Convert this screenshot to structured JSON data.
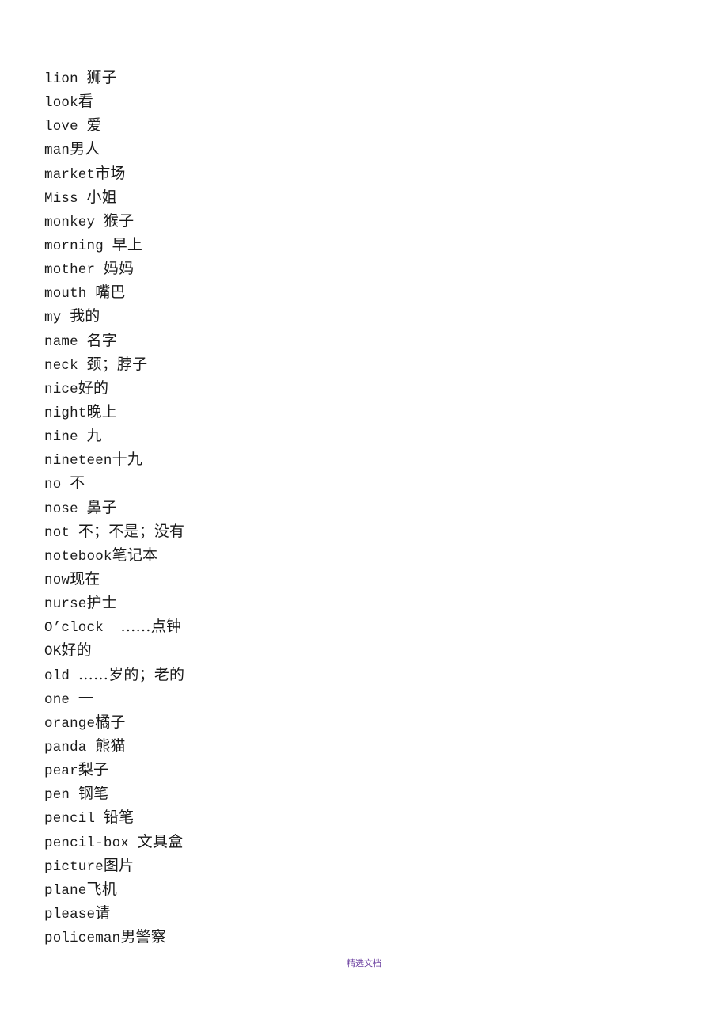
{
  "document": {
    "entries": [
      {
        "en": "lion",
        "sep": " ",
        "zh": "狮子"
      },
      {
        "en": "look",
        "sep": "",
        "zh": "看"
      },
      {
        "en": "love",
        "sep": " ",
        "zh": "爱"
      },
      {
        "en": "man",
        "sep": "",
        "zh": "男人"
      },
      {
        "en": "market",
        "sep": "",
        "zh": "市场"
      },
      {
        "en": "Miss",
        "sep": " ",
        "zh": "小姐"
      },
      {
        "en": "monkey",
        "sep": " ",
        "zh": "猴子"
      },
      {
        "en": "morning",
        "sep": " ",
        "zh": "早上"
      },
      {
        "en": "mother",
        "sep": " ",
        "zh": "妈妈"
      },
      {
        "en": "mouth",
        "sep": " ",
        "zh": "嘴巴"
      },
      {
        "en": "my",
        "sep": " ",
        "zh": "我的"
      },
      {
        "en": "name",
        "sep": " ",
        "zh": "名字"
      },
      {
        "en": "neck",
        "sep": " ",
        "zh": "颈；脖子"
      },
      {
        "en": "nice",
        "sep": "",
        "zh": "好的"
      },
      {
        "en": "night",
        "sep": "",
        "zh": "晚上"
      },
      {
        "en": "nine",
        "sep": " ",
        "zh": "九"
      },
      {
        "en": "nineteen",
        "sep": "",
        "zh": "十九"
      },
      {
        "en": "no",
        "sep": " ",
        "zh": "不"
      },
      {
        "en": "nose",
        "sep": " ",
        "zh": "鼻子"
      },
      {
        "en": "not",
        "sep": " ",
        "zh": "不；不是；没有"
      },
      {
        "en": "notebook",
        "sep": "",
        "zh": "笔记本"
      },
      {
        "en": "now",
        "sep": "",
        "zh": "现在"
      },
      {
        "en": "nurse",
        "sep": "",
        "zh": "护士"
      },
      {
        "en": "O’clock",
        "sep": "  ",
        "zh": "……点钟"
      },
      {
        "en": "OK",
        "sep": "",
        "zh": "好的"
      },
      {
        "en": "old",
        "sep": " ",
        "zh": "……岁的；老的"
      },
      {
        "en": "one",
        "sep": " ",
        "zh": "一"
      },
      {
        "en": "orange",
        "sep": "",
        "zh": "橘子"
      },
      {
        "en": "panda",
        "sep": " ",
        "zh": "熊猫"
      },
      {
        "en": "pear",
        "sep": "",
        "zh": "梨子"
      },
      {
        "en": "pen",
        "sep": " ",
        "zh": "钢笔"
      },
      {
        "en": "pencil",
        "sep": " ",
        "zh": "铅笔"
      },
      {
        "en": "pencil-box",
        "sep": " ",
        "zh": "文具盒"
      },
      {
        "en": "picture",
        "sep": "",
        "zh": "图片"
      },
      {
        "en": "plane",
        "sep": "",
        "zh": "飞机"
      },
      {
        "en": "please",
        "sep": "",
        "zh": "请"
      },
      {
        "en": "policeman",
        "sep": "",
        "zh": "男警察"
      }
    ],
    "footer": "精选文档"
  }
}
